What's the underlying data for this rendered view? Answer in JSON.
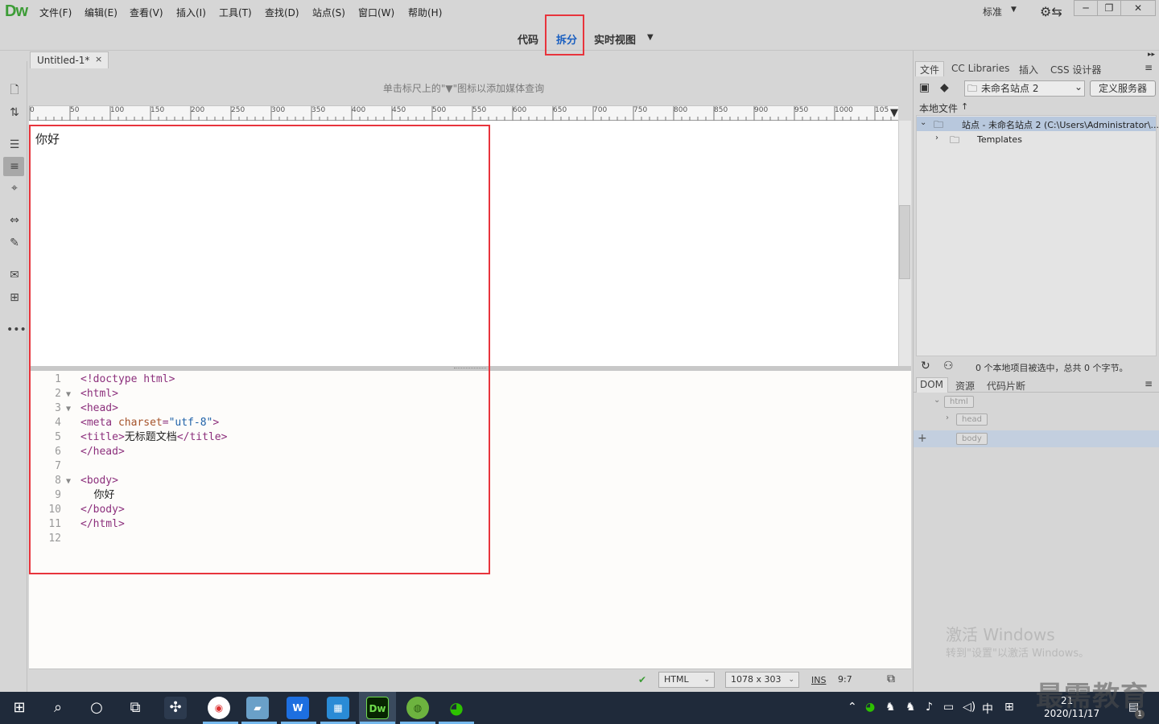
{
  "app": {
    "logo": "Dw"
  },
  "menu": [
    "文件(F)",
    "编辑(E)",
    "查看(V)",
    "插入(I)",
    "工具(T)",
    "查找(D)",
    "站点(S)",
    "窗口(W)",
    "帮助(H)"
  ],
  "workspace": "标准",
  "view_tabs": {
    "code": "代码",
    "split": "拆分",
    "live": "实时视图"
  },
  "document": {
    "tab_title": "Untitled-1*",
    "close_glyph": "×"
  },
  "media_query_hint": "单击标尺上的\"▼\"图标以添加媒体查询",
  "ruler_ticks": [
    "0",
    "50",
    "100",
    "150",
    "200",
    "250",
    "300",
    "350",
    "400",
    "450",
    "500",
    "550",
    "600",
    "650",
    "700",
    "750",
    "800",
    "850",
    "900",
    "950",
    "1000",
    "105"
  ],
  "design_text": "你好",
  "code_lines": [
    {
      "n": "1",
      "fold": "",
      "parts": [
        {
          "c": "tag",
          "t": "<!doctype html>"
        }
      ]
    },
    {
      "n": "2",
      "fold": "▼",
      "parts": [
        {
          "c": "tag",
          "t": "<html>"
        }
      ]
    },
    {
      "n": "3",
      "fold": "▼",
      "parts": [
        {
          "c": "tag",
          "t": "<head>"
        }
      ]
    },
    {
      "n": "4",
      "fold": "",
      "parts": [
        {
          "c": "tag",
          "t": "<meta "
        },
        {
          "c": "attr",
          "t": "charset"
        },
        {
          "c": "tag",
          "t": "="
        },
        {
          "c": "val",
          "t": "\"utf-8\""
        },
        {
          "c": "tag",
          "t": ">"
        }
      ]
    },
    {
      "n": "5",
      "fold": "",
      "parts": [
        {
          "c": "tag",
          "t": "<title>"
        },
        {
          "c": "txt",
          "t": "无标题文档"
        },
        {
          "c": "tag",
          "t": "</title>"
        }
      ]
    },
    {
      "n": "6",
      "fold": "",
      "parts": [
        {
          "c": "tag",
          "t": "</head>"
        }
      ]
    },
    {
      "n": "7",
      "fold": "",
      "parts": []
    },
    {
      "n": "8",
      "fold": "▼",
      "parts": [
        {
          "c": "tag",
          "t": "<body>"
        }
      ]
    },
    {
      "n": "9",
      "fold": "",
      "parts": [
        {
          "c": "txt",
          "t": "    你好"
        }
      ]
    },
    {
      "n": "10",
      "fold": "",
      "parts": [
        {
          "c": "tag",
          "t": "</body>"
        }
      ]
    },
    {
      "n": "11",
      "fold": "",
      "parts": [
        {
          "c": "tag",
          "t": "</html>"
        }
      ]
    },
    {
      "n": "12",
      "fold": "",
      "parts": []
    }
  ],
  "status": {
    "doc_type": "HTML",
    "size": "1078 x 303",
    "ins": "INS",
    "cursor": "9:7"
  },
  "right_panel": {
    "tabs": [
      "文件",
      "CC Libraries",
      "插入",
      "CSS 设计器"
    ],
    "site_select": "未命名站点 2",
    "define_server": "定义服务器",
    "local_files": "本地文件",
    "tree_site": "站点 - 未命名站点 2 (C:\\Users\\Administrator\\...",
    "tree_folder": "Templates",
    "files_status": "0 个本地项目被选中，总共 0 个字节。",
    "dom_tabs": [
      "DOM",
      "资源",
      "代码片断"
    ],
    "dom_nodes": [
      "html",
      "head",
      "body"
    ]
  },
  "activation": {
    "title": "激活 Windows",
    "subtitle": "转到\"设置\"以激活 Windows。"
  },
  "watermark": "最需教育",
  "taskbar": {
    "time": "21",
    "date": "2020/11/17",
    "ime": "中",
    "notification_count": "1"
  },
  "colors": {
    "highlight": "#e8343c",
    "dw_green": "#3c9c36",
    "split_active": "#1a5fc0"
  }
}
